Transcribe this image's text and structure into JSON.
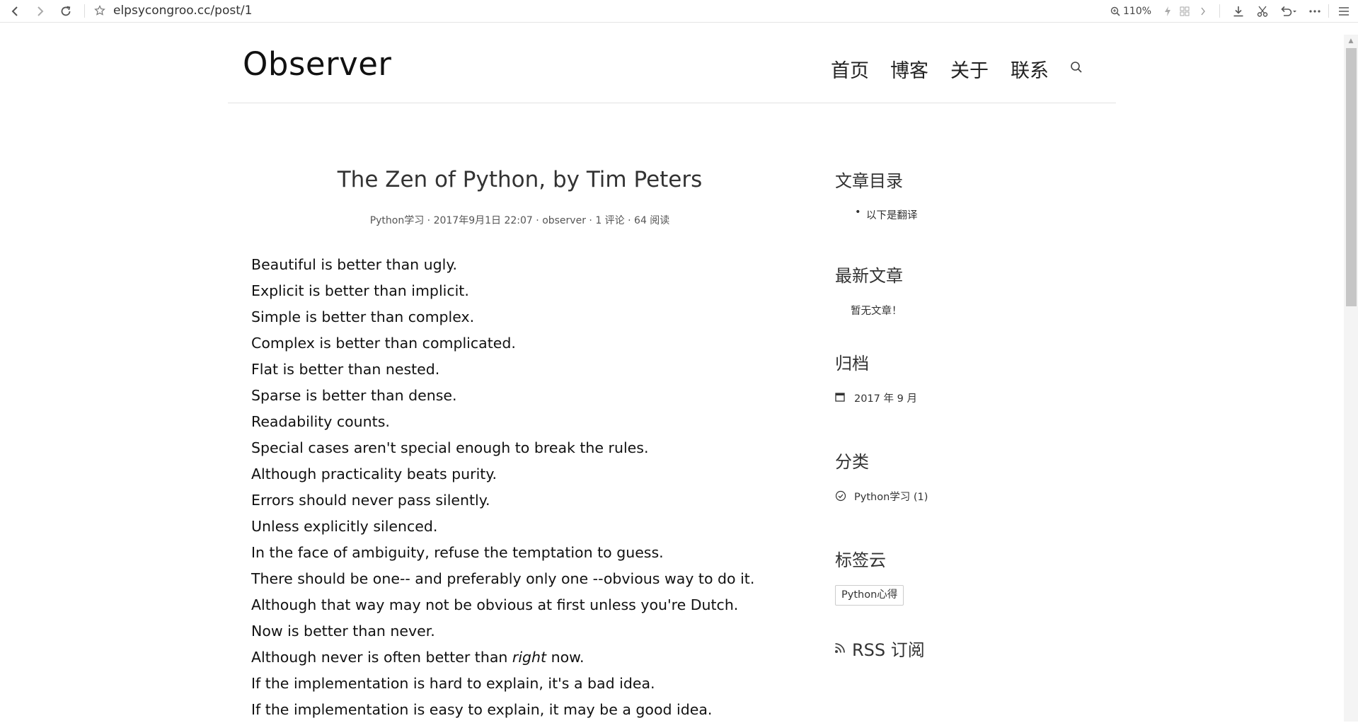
{
  "browser": {
    "url": "elpsycongroo.cc/post/1",
    "zoom": "110%"
  },
  "header": {
    "site_title": "Observer",
    "nav": [
      "首页",
      "博客",
      "关于",
      "联系"
    ]
  },
  "post": {
    "title": "The Zen of Python, by Tim Peters",
    "meta": {
      "category": "Python学习",
      "date": "2017年9月1日 22:07",
      "author": "observer",
      "comments": "1 评论",
      "views": "64 阅读"
    },
    "lines": [
      "Beautiful is better than ugly.",
      "Explicit is better than implicit.",
      "Simple is better than complex.",
      "Complex is better than complicated.",
      "Flat is better than nested.",
      "Sparse is better than dense.",
      "Readability counts.",
      "Special cases aren't special enough to break the rules.",
      "Although practicality beats purity.",
      "Errors should never pass silently.",
      "Unless explicitly silenced.",
      "In the face of ambiguity, refuse the temptation to guess.",
      "There should be one-- and preferably only one --obvious way to do it.",
      "Although that way may not be obvious at first unless you're Dutch.",
      "Now is better than never.",
      "Although never is often better than *right* now.",
      "If the implementation is hard to explain, it's a bad idea.",
      "If the implementation is easy to explain, it may be a good idea."
    ],
    "line16": {
      "before": "Although never is often better than ",
      "em": "right",
      "after": " now."
    }
  },
  "sidebar": {
    "toc": {
      "title": "文章目录",
      "items": [
        "以下是翻译"
      ]
    },
    "recent": {
      "title": "最新文章",
      "empty": "暂无文章！"
    },
    "archive": {
      "title": "归档",
      "items": [
        "2017 年 9 月"
      ]
    },
    "categories": {
      "title": "分类",
      "items": [
        "Python学习 (1)"
      ]
    },
    "tags": {
      "title": "标签云",
      "items": [
        "Python心得"
      ]
    },
    "rss": {
      "label": "RSS 订阅"
    }
  }
}
